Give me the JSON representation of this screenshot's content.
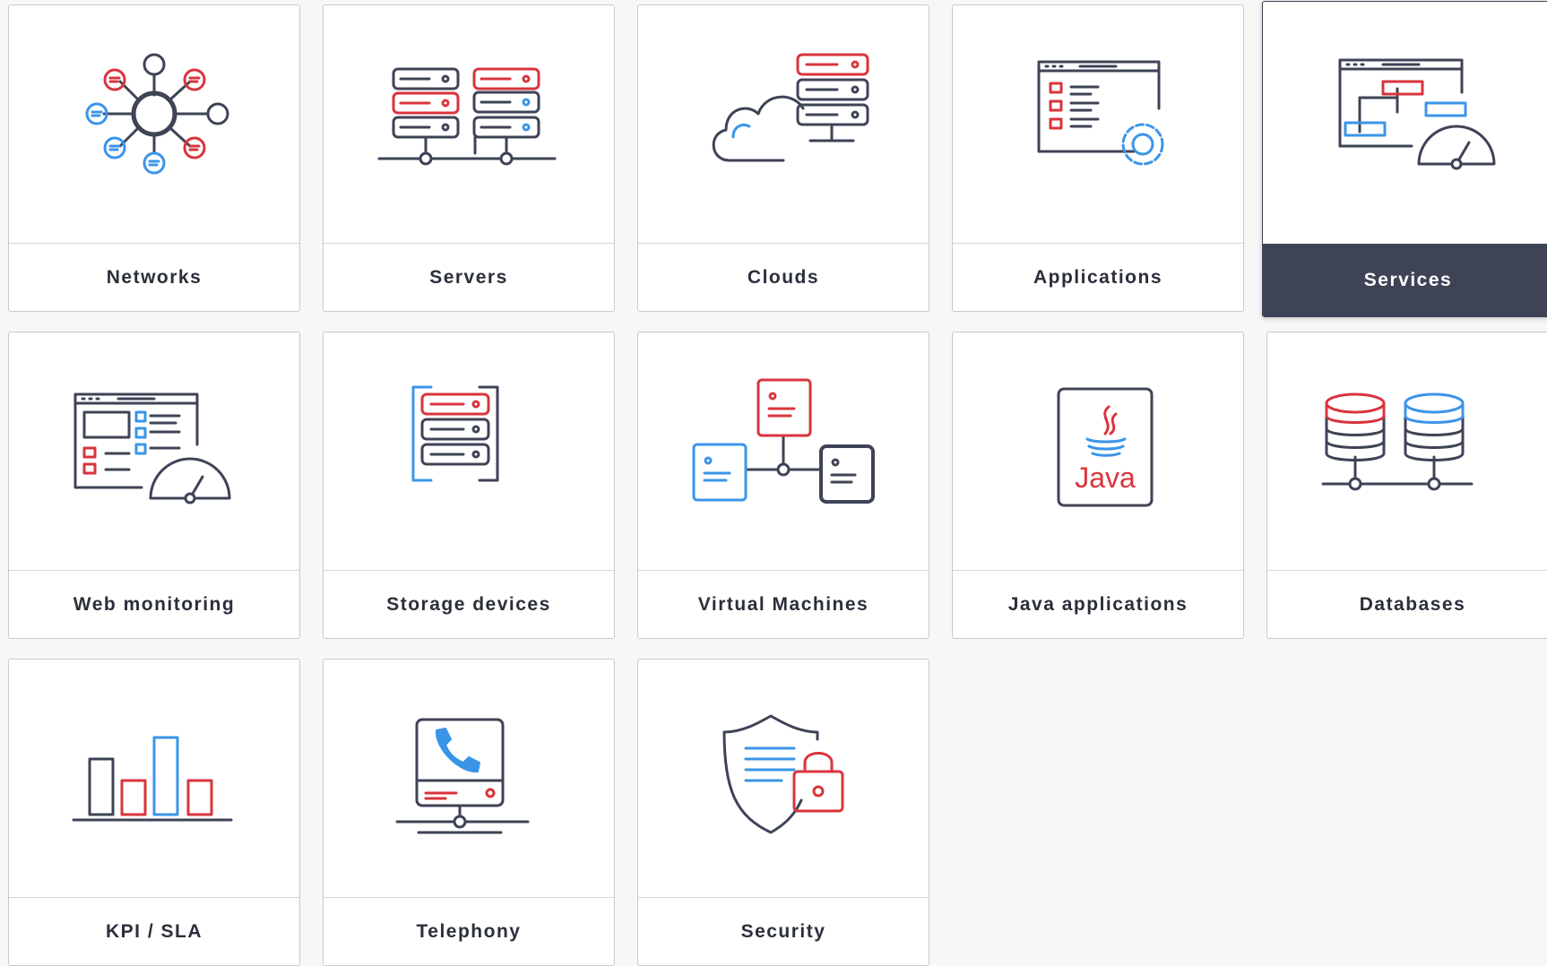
{
  "colors": {
    "dark": "#3e4356",
    "red": "#d9343d",
    "blue": "#3a95e8",
    "selected_background": "#3e4356"
  },
  "categories": [
    {
      "label": "Networks",
      "icon": "network-topology-icon",
      "selected": false
    },
    {
      "label": "Servers",
      "icon": "server-racks-icon",
      "selected": false
    },
    {
      "label": "Clouds",
      "icon": "cloud-server-icon",
      "selected": false
    },
    {
      "label": "Applications",
      "icon": "application-settings-icon",
      "selected": false
    },
    {
      "label": "Services",
      "icon": "service-dashboard-icon",
      "selected": true
    },
    {
      "label": "Web monitoring",
      "icon": "web-monitoring-icon",
      "selected": false
    },
    {
      "label": "Storage devices",
      "icon": "storage-device-icon",
      "selected": false
    },
    {
      "label": "Virtual Machines",
      "icon": "virtual-machines-icon",
      "selected": false
    },
    {
      "label": "Java applications",
      "icon": "java-logo-icon",
      "selected": false
    },
    {
      "label": "Databases",
      "icon": "database-icon",
      "selected": false
    },
    {
      "label": "KPI / SLA",
      "icon": "bar-chart-icon",
      "selected": false
    },
    {
      "label": "Telephony",
      "icon": "telephone-icon",
      "selected": false
    },
    {
      "label": "Security",
      "icon": "shield-lock-icon",
      "selected": false
    }
  ],
  "java_logo_text": "Java"
}
